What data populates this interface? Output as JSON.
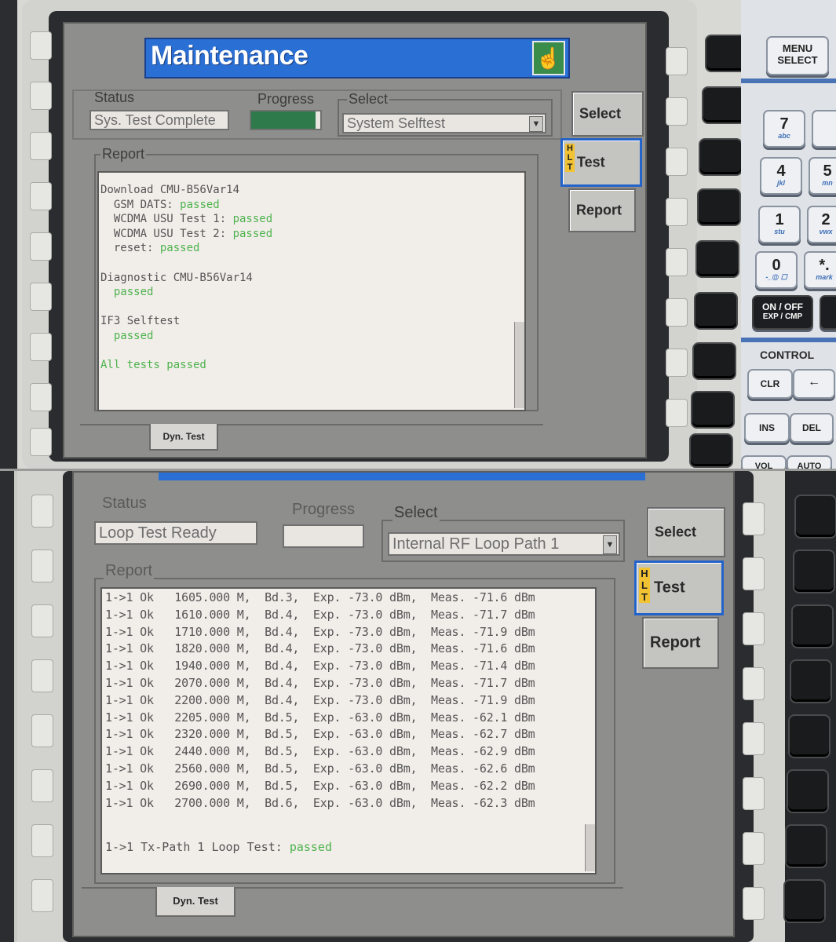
{
  "top_screen": {
    "title": "Maintenance",
    "status_label": "Status",
    "status_value": "Sys. Test Complete",
    "progress_label": "Progress",
    "progress_fraction": 0.93,
    "select_label": "Select",
    "select_value": "System Selftest",
    "report_label": "Report",
    "report_lines": [
      {
        "text": "Download CMU-B56Var14",
        "status": ""
      },
      {
        "text": "  GSM DATS: ",
        "status": "passed"
      },
      {
        "text": "  WCDMA USU Test 1: ",
        "status": "passed"
      },
      {
        "text": "  WCDMA USU Test 2: ",
        "status": "passed"
      },
      {
        "text": "  reset: ",
        "status": "passed"
      },
      {
        "text": "",
        "status": ""
      },
      {
        "text": "Diagnostic CMU-B56Var14",
        "status": ""
      },
      {
        "text": "  ",
        "status": "passed"
      },
      {
        "text": "",
        "status": ""
      },
      {
        "text": "IF3 Selftest",
        "status": ""
      },
      {
        "text": "  ",
        "status": "passed"
      },
      {
        "text": "",
        "status": ""
      },
      {
        "text": "",
        "status": "All tests passed"
      }
    ],
    "side_buttons": [
      "Select",
      "Test",
      "Report"
    ],
    "hlt": "HLT",
    "tab_label": "Dyn. Test"
  },
  "bottom_screen": {
    "status_label": "Status",
    "status_value": "Loop Test Ready",
    "progress_label": "Progress",
    "progress_fraction": 0,
    "select_label": "Select",
    "select_value": "Internal RF Loop Path 1",
    "report_label": "Report",
    "rows": [
      "1->1 Ok   1605.000 M,  Bd.3,  Exp. -73.0 dBm,  Meas. -71.6 dBm",
      "1->1 Ok   1610.000 M,  Bd.4,  Exp. -73.0 dBm,  Meas. -71.7 dBm",
      "1->1 Ok   1710.000 M,  Bd.4,  Exp. -73.0 dBm,  Meas. -71.9 dBm",
      "1->1 Ok   1820.000 M,  Bd.4,  Exp. -73.0 dBm,  Meas. -71.6 dBm",
      "1->1 Ok   1940.000 M,  Bd.4,  Exp. -73.0 dBm,  Meas. -71.4 dBm",
      "1->1 Ok   2070.000 M,  Bd.4,  Exp. -73.0 dBm,  Meas. -71.7 dBm",
      "1->1 Ok   2200.000 M,  Bd.4,  Exp. -73.0 dBm,  Meas. -71.9 dBm",
      "1->1 Ok   2205.000 M,  Bd.5,  Exp. -63.0 dBm,  Meas. -62.1 dBm",
      "1->1 Ok   2320.000 M,  Bd.5,  Exp. -63.0 dBm,  Meas. -62.7 dBm",
      "1->1 Ok   2440.000 M,  Bd.5,  Exp. -63.0 dBm,  Meas. -62.9 dBm",
      "1->1 Ok   2560.000 M,  Bd.5,  Exp. -63.0 dBm,  Meas. -62.6 dBm",
      "1->1 Ok   2690.000 M,  Bd.5,  Exp. -63.0 dBm,  Meas. -62.2 dBm",
      "1->1 Ok   2700.000 M,  Bd.6,  Exp. -63.0 dBm,  Meas. -62.3 dBm"
    ],
    "summary_text": "1->1 Tx-Path 1 Loop Test: ",
    "summary_status": "passed",
    "side_buttons": [
      "Select",
      "Test",
      "Report"
    ],
    "hlt": "HLT",
    "tab_label": "Dyn. Test"
  },
  "keypad": {
    "menu_select": [
      "MENU",
      "SELECT"
    ],
    "digits": [
      {
        "big": "7",
        "small": "abc"
      },
      {
        "big": "4",
        "small": "jkl"
      },
      {
        "big": "5",
        "small": "mn"
      },
      {
        "big": "1",
        "small": "stu"
      },
      {
        "big": "2",
        "small": "vwx"
      },
      {
        "big": "0",
        "small": "-_@ ☐"
      },
      {
        "big": "*.",
        "small": "mark"
      }
    ],
    "on_off": [
      "ON / OFF",
      "EXP / CMP"
    ],
    "control_label": "CONTROL",
    "clr": "CLR",
    "ins": "INS",
    "del": "DEL",
    "vol": "VOL",
    "auto": "AUTO"
  }
}
